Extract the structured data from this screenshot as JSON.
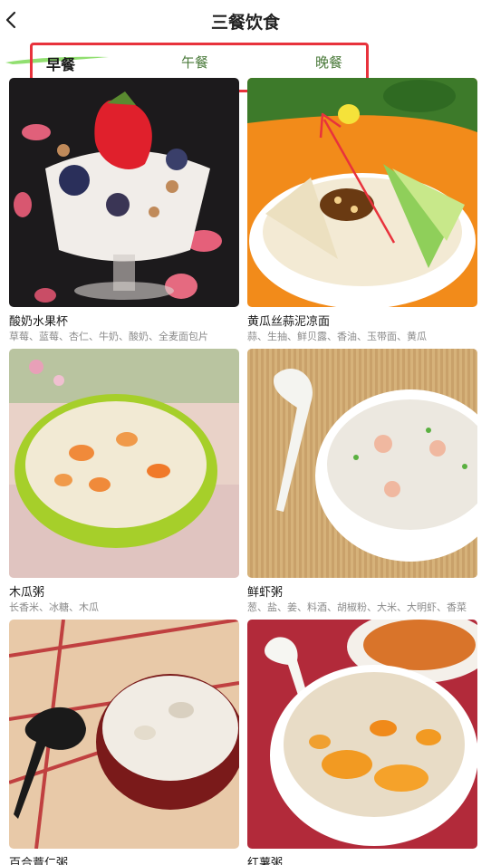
{
  "header": {
    "title": "三餐饮食"
  },
  "tabs": [
    {
      "label": "早餐",
      "active": true
    },
    {
      "label": "午餐",
      "active": false
    },
    {
      "label": "晚餐",
      "active": false
    }
  ],
  "colors": {
    "highlight_border": "#e8323c",
    "tab_inactive": "#4a7a3a",
    "indicator": "#7ed957"
  },
  "recipes": [
    {
      "name": "酸奶水果杯",
      "ingredients": "草莓、蓝莓、杏仁、牛奶、酸奶、全麦面包片"
    },
    {
      "name": "黄瓜丝蒜泥凉面",
      "ingredients": "蒜、生抽、鲜贝露、香油、玉带面、黄瓜"
    },
    {
      "name": "木瓜粥",
      "ingredients": "长香米、冰糖、木瓜"
    },
    {
      "name": "鲜虾粥",
      "ingredients": "葱、盐、姜、料酒、胡椒粉、大米、大明虾、香菜"
    },
    {
      "name": "百合薏仁粥",
      "ingredients": ""
    },
    {
      "name": "红薯粥",
      "ingredients": ""
    }
  ]
}
